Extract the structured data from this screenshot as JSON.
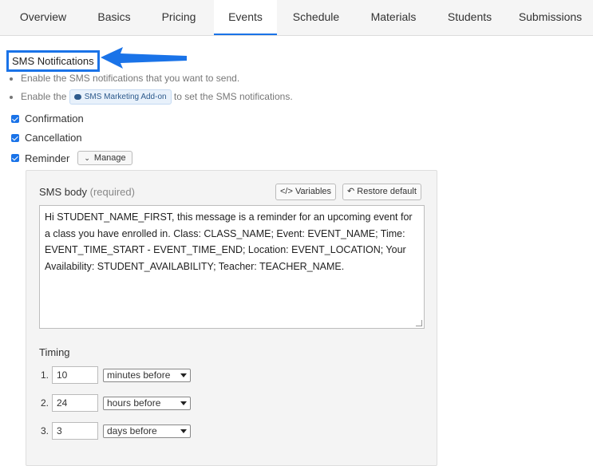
{
  "tabs": [
    {
      "label": "Overview",
      "active": false
    },
    {
      "label": "Basics",
      "active": false
    },
    {
      "label": "Pricing",
      "active": false
    },
    {
      "label": "Events",
      "active": true
    },
    {
      "label": "Schedule",
      "active": false
    },
    {
      "label": "Materials",
      "active": false
    },
    {
      "label": "Students",
      "active": false
    },
    {
      "label": "Submissions",
      "active": false
    }
  ],
  "section": {
    "title": "SMS Notifications",
    "highlight_color": "#1a73e8",
    "bullet1": "Enable the SMS notifications that you want to send.",
    "bullet2_prefix": "Enable the",
    "addon_label": "SMS Marketing Add-on",
    "bullet2_suffix": "to set the SMS notifications."
  },
  "checks": {
    "confirmation": {
      "label": "Confirmation",
      "checked": true
    },
    "cancellation": {
      "label": "Cancellation",
      "checked": true
    },
    "reminder": {
      "label": "Reminder",
      "checked": true
    },
    "manage_label": "Manage"
  },
  "sms_panel": {
    "body_label": "SMS body",
    "required_label": "(required)",
    "variables_label": "Variables",
    "restore_label": "Restore default",
    "body_text": "Hi STUDENT_NAME_FIRST, this message is a reminder for an upcoming event for a class you have enrolled in. Class: CLASS_NAME; Event: EVENT_NAME; Time: EVENT_TIME_START - EVENT_TIME_END; Location: EVENT_LOCATION; Your Availability: STUDENT_AVAILABILITY; Teacher: TEACHER_NAME.",
    "timing_label": "Timing",
    "timing": [
      {
        "index": "1.",
        "value": "10",
        "unit": "minutes before"
      },
      {
        "index": "2.",
        "value": "24",
        "unit": "hours before"
      },
      {
        "index": "3.",
        "value": "3",
        "unit": "days before"
      }
    ]
  },
  "colors": {
    "accent": "#1a73e8",
    "panel_bg": "#f4f4f4"
  }
}
